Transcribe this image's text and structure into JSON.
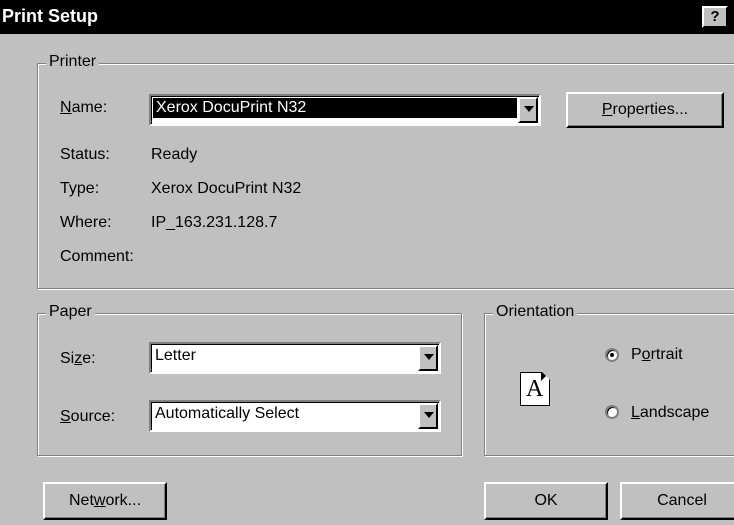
{
  "window": {
    "title": "Print Setup",
    "help_label": "?"
  },
  "printer": {
    "group_label": "Printer",
    "name_label": "Name:",
    "name_value": "Xerox DocuPrint N32",
    "properties_label": "Properties...",
    "status_label": "Status:",
    "status_value": "Ready",
    "type_label": "Type:",
    "type_value": "Xerox DocuPrint N32",
    "where_label": "Where:",
    "where_value": "IP_163.231.128.7",
    "comment_label": "Comment:",
    "comment_value": ""
  },
  "paper": {
    "group_label": "Paper",
    "size_label": "Size:",
    "size_value": "Letter",
    "source_label": "Source:",
    "source_value": "Automatically Select"
  },
  "orientation": {
    "group_label": "Orientation",
    "icon_letter": "A",
    "portrait_label": "Portrait",
    "landscape_label": "Landscape",
    "selected": "Portrait"
  },
  "buttons": {
    "network": "Network...",
    "ok": "OK",
    "cancel": "Cancel"
  }
}
